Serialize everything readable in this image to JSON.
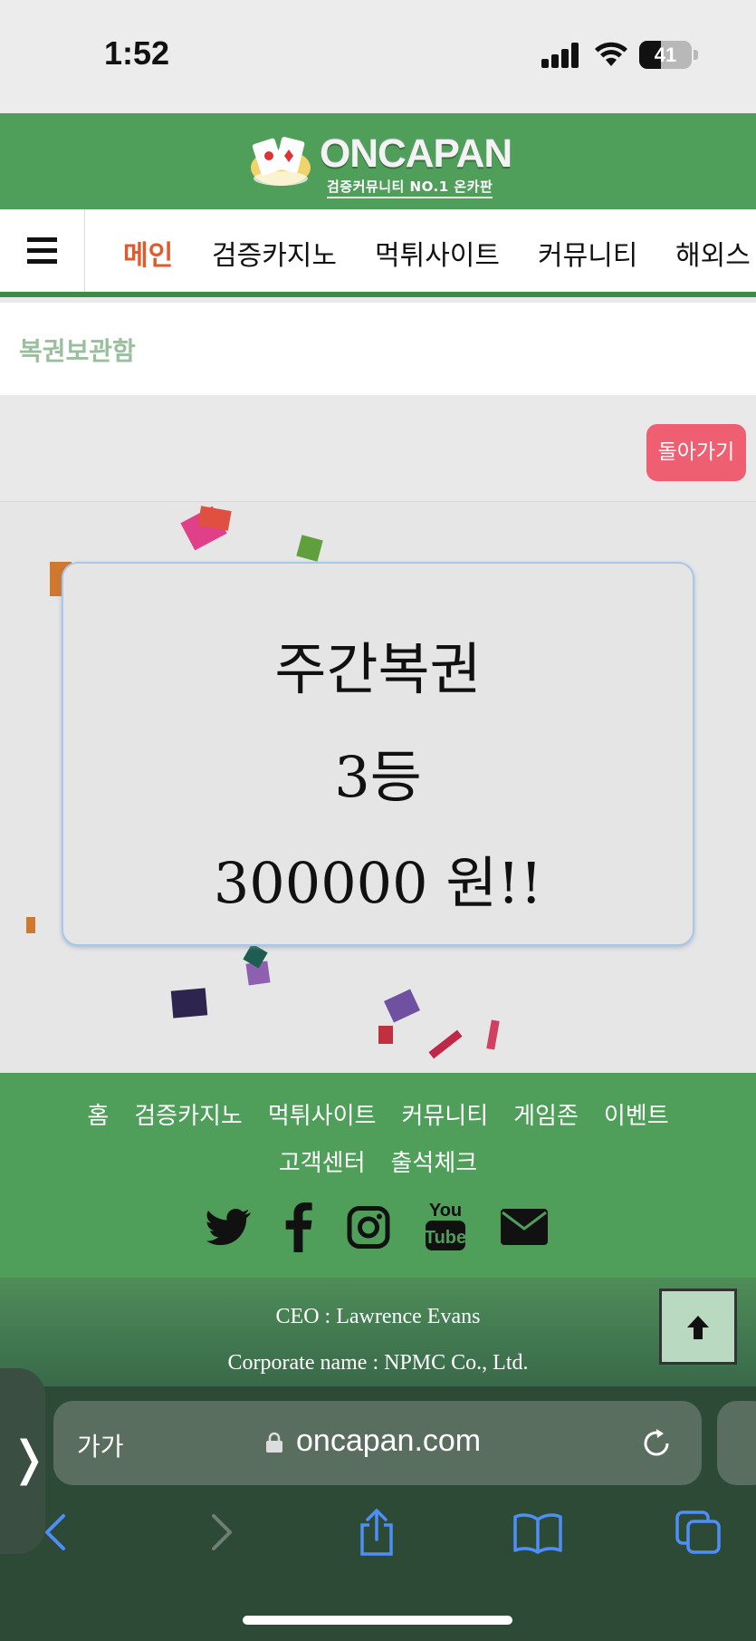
{
  "status_bar": {
    "time": "1:52",
    "battery": "41"
  },
  "header": {
    "logo_text": "ONCAPAN",
    "logo_subtitle": "검증커뮤니티 NO.1 온카판"
  },
  "nav": {
    "menu_icon": "hamburger-icon",
    "items": [
      {
        "label": "메인",
        "active": true
      },
      {
        "label": "검증카지노",
        "active": false
      },
      {
        "label": "먹튀사이트",
        "active": false
      },
      {
        "label": "커뮤니티",
        "active": false
      },
      {
        "label": "해외스",
        "active": false
      }
    ]
  },
  "page": {
    "title": "복권보관함",
    "back_button": "돌아가기",
    "prize": {
      "name": "주간복권",
      "rank": "3등",
      "amount": "300000 원!!"
    }
  },
  "footer": {
    "links": [
      "홈",
      "검증카지노",
      "먹튀사이트",
      "커뮤니티",
      "게임존",
      "이벤트",
      "고객센터",
      "출석체크"
    ],
    "social_icons": [
      "twitter-icon",
      "facebook-icon",
      "instagram-icon",
      "youtube-icon",
      "mail-icon"
    ],
    "ceo": "CEO : Lawrence Evans",
    "corporate": "Corporate name : NPMC Co., Ltd."
  },
  "browser": {
    "text_size": "가가",
    "url": "oncapan.com",
    "toolbar_icons": [
      "back-icon",
      "forward-icon",
      "share-icon",
      "bookmarks-icon",
      "tabs-icon"
    ]
  },
  "colors": {
    "brand_green": "#4f9f5b",
    "active_nav": "#e25a2c",
    "back_button": "#ef5f72"
  }
}
